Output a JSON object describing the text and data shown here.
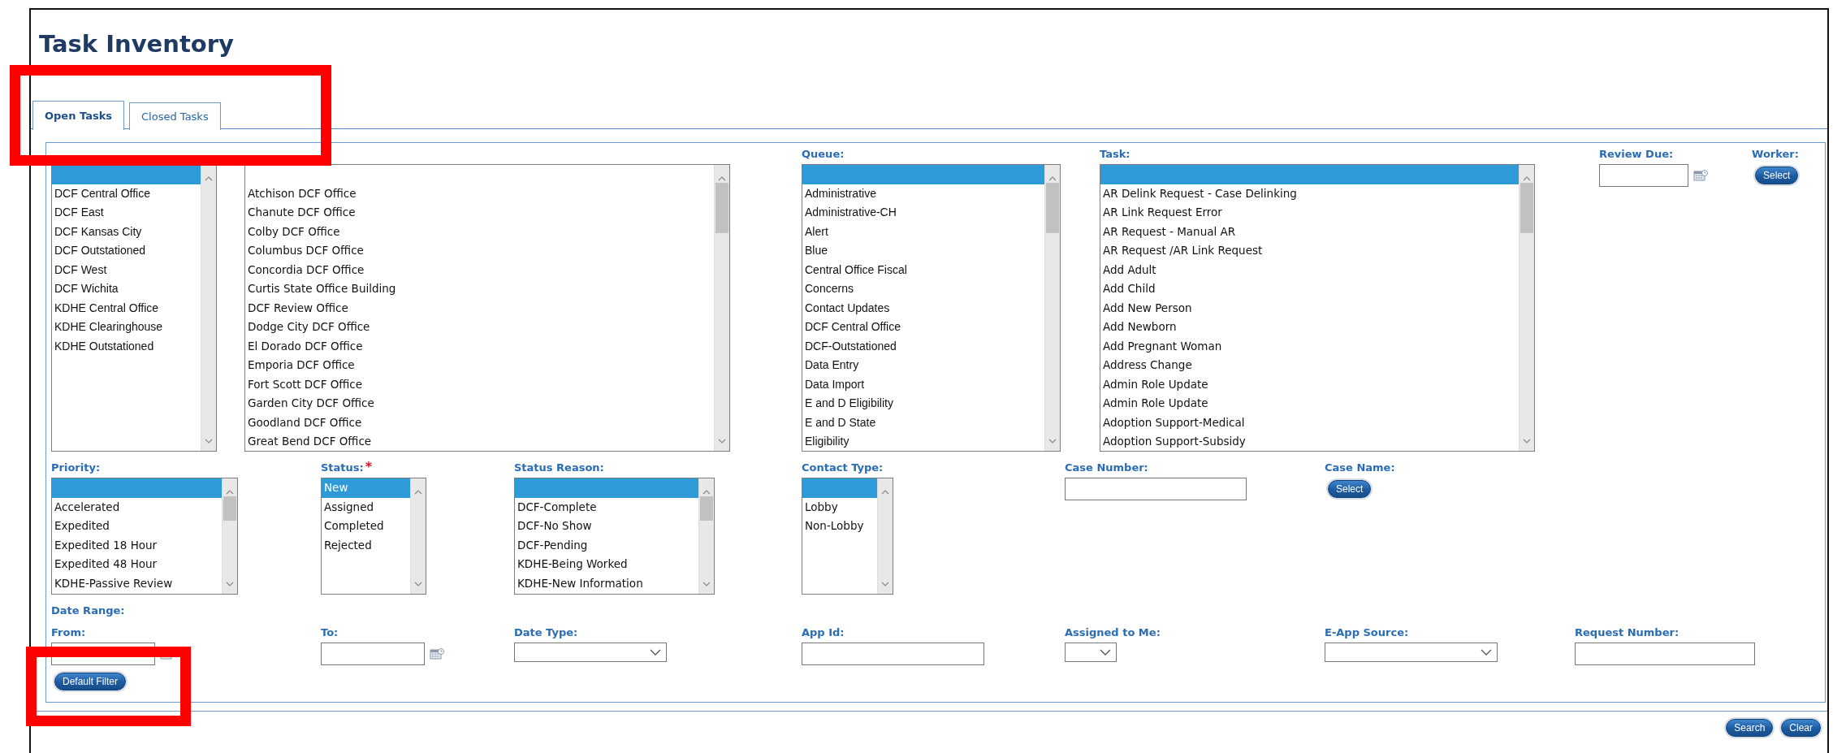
{
  "page": {
    "title": "Task Inventory"
  },
  "tabs": [
    {
      "label": "Open Tasks",
      "selected": true
    },
    {
      "label": "Closed Tasks",
      "selected": false
    }
  ],
  "filters_top": [
    {
      "kind": "listbox",
      "blank_row": true,
      "blank_selected": true,
      "options": [
        {
          "text": "DCF Central Office",
          "selected": false
        },
        {
          "text": "DCF East",
          "selected": false
        },
        {
          "text": "DCF Kansas City",
          "selected": false
        },
        {
          "text": "DCF Outstationed",
          "selected": false
        },
        {
          "text": "DCF West",
          "selected": false
        },
        {
          "text": "DCF Wichita",
          "selected": false
        },
        {
          "text": "KDHE Central Office",
          "selected": false
        },
        {
          "text": "KDHE Clearinghouse",
          "selected": false
        },
        {
          "text": "KDHE Outstationed",
          "selected": false
        }
      ]
    },
    {
      "kind": "listbox",
      "blank_row": true,
      "blank_selected": false,
      "options": [
        {
          "text": "Atchison DCF Office",
          "selected": false
        },
        {
          "text": "Chanute DCF Office",
          "selected": false
        },
        {
          "text": "Colby DCF Office",
          "selected": false
        },
        {
          "text": "Columbus DCF Office",
          "selected": false
        },
        {
          "text": "Concordia DCF Office",
          "selected": false
        },
        {
          "text": "Curtis State Office Building",
          "selected": false
        },
        {
          "text": "DCF Review Office",
          "selected": false
        },
        {
          "text": "Dodge City DCF Office",
          "selected": false
        },
        {
          "text": "El Dorado DCF Office",
          "selected": false
        },
        {
          "text": "Emporia DCF Office",
          "selected": false
        },
        {
          "text": "Fort Scott DCF Office",
          "selected": false
        },
        {
          "text": "Garden City DCF Office",
          "selected": false
        },
        {
          "text": "Goodland DCF Office",
          "selected": false
        },
        {
          "text": "Great Bend DCF Office",
          "selected": false
        }
      ]
    },
    {
      "kind": "listbox",
      "label": "Queue:",
      "blank_row": true,
      "blank_selected": true,
      "options": [
        {
          "text": "Administrative",
          "selected": false
        },
        {
          "text": "Administrative-CH",
          "selected": false
        },
        {
          "text": "Alert",
          "selected": false
        },
        {
          "text": "Blue",
          "selected": false
        },
        {
          "text": "Central Office Fiscal",
          "selected": false
        },
        {
          "text": "Concerns",
          "selected": false
        },
        {
          "text": "Contact Updates",
          "selected": false
        },
        {
          "text": "DCF Central Office",
          "selected": false
        },
        {
          "text": "DCF-Outstationed",
          "selected": false
        },
        {
          "text": "Data Entry",
          "selected": false
        },
        {
          "text": "Data Import",
          "selected": false
        },
        {
          "text": "E and D Eligibility",
          "selected": false
        },
        {
          "text": "E and D State",
          "selected": false
        },
        {
          "text": "Eligibility",
          "selected": false
        }
      ]
    },
    {
      "kind": "listbox",
      "label": "Task:",
      "blank_row": true,
      "blank_selected": true,
      "options": [
        {
          "text": "AR Delink Request - Case Delinking",
          "selected": false
        },
        {
          "text": "AR Link Request Error",
          "selected": false
        },
        {
          "text": "AR Request - Manual AR",
          "selected": false
        },
        {
          "text": "AR Request /AR Link Request",
          "selected": false
        },
        {
          "text": "Add Adult",
          "selected": false
        },
        {
          "text": "Add Child",
          "selected": false
        },
        {
          "text": "Add New Person",
          "selected": false
        },
        {
          "text": "Add Newborn",
          "selected": false
        },
        {
          "text": "Add Pregnant Woman",
          "selected": false
        },
        {
          "text": "Address Change",
          "selected": false
        },
        {
          "text": "Admin Role Update",
          "selected": false
        },
        {
          "text": "Admin Role Update",
          "selected": false
        },
        {
          "text": "Adoption Support-Medical",
          "selected": false
        },
        {
          "text": "Adoption Support-Subsidy",
          "selected": false
        }
      ]
    },
    {
      "kind": "date",
      "label": "Review Due:"
    },
    {
      "kind": "picker",
      "label": "Worker:",
      "button": "Select"
    }
  ],
  "filters_middle": [
    {
      "kind": "listbox",
      "label": "Priority:",
      "blank_row": true,
      "blank_selected": true,
      "options": [
        {
          "text": "Accelerated",
          "selected": false
        },
        {
          "text": "Expedited",
          "selected": false
        },
        {
          "text": "Expedited 18 Hour",
          "selected": false
        },
        {
          "text": "Expedited 48 Hour",
          "selected": false
        },
        {
          "text": "KDHE-Passive Review",
          "selected": false
        }
      ]
    },
    {
      "kind": "listbox",
      "label": "Status:",
      "required_mark": "*",
      "blank_row": false,
      "options": [
        {
          "text": "New",
          "selected": true
        },
        {
          "text": "Assigned",
          "selected": false
        },
        {
          "text": "Completed",
          "selected": false
        },
        {
          "text": "Rejected",
          "selected": false
        }
      ]
    },
    {
      "kind": "listbox",
      "label": "Status Reason:",
      "blank_row": true,
      "blank_selected": true,
      "options": [
        {
          "text": "DCF-Complete",
          "selected": false
        },
        {
          "text": "DCF-No Show",
          "selected": false
        },
        {
          "text": "DCF-Pending",
          "selected": false
        },
        {
          "text": "KDHE-Being Worked",
          "selected": false
        },
        {
          "text": "KDHE-New Information",
          "selected": false
        }
      ]
    },
    {
      "kind": "listbox",
      "label": "Contact Type:",
      "blank_row": true,
      "blank_selected": true,
      "options": [
        {
          "text": "Lobby",
          "selected": false
        },
        {
          "text": "Non-Lobby",
          "selected": false
        }
      ]
    },
    {
      "kind": "text",
      "label": "Case Number:"
    },
    {
      "kind": "picker",
      "label": "Case Name:",
      "button": "Select"
    }
  ],
  "date_range_label": "Date Range:",
  "filters_bottom": [
    {
      "kind": "date",
      "label": "From:"
    },
    {
      "kind": "date",
      "label": "To:"
    },
    {
      "kind": "select",
      "label": "Date Type:"
    },
    {
      "kind": "text",
      "label": "App Id:"
    },
    {
      "kind": "select",
      "label": "Assigned to Me:"
    },
    {
      "kind": "select",
      "label": "E-App Source:"
    },
    {
      "kind": "text",
      "label": "Request Number:"
    }
  ],
  "default_button": "Default Filter",
  "actions": [
    "Search",
    "Clear"
  ]
}
